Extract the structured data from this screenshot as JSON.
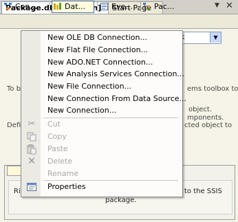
{
  "doc_tabs": {
    "active": "Package.dtsx [Design]*",
    "start": "Start Page",
    "pin_icon": "dropdown-arrow-icon",
    "close_icon": "close-icon"
  },
  "designer_tabs": [
    {
      "label": "Con...",
      "icon": "control-flow-icon"
    },
    {
      "label": "Dat...",
      "icon": "data-flow-icon"
    },
    {
      "label": "Eve...",
      "icon": "event-handlers-icon"
    },
    {
      "label": "Pac...",
      "icon": "package-explorer-icon"
    }
  ],
  "background_text": {
    "left_1": "To b",
    "right_1": "ems toolbox to",
    "right_2": "object.",
    "right_3": "mponents.",
    "left_2": "Defi",
    "right_4": "cted object to",
    "bottom_left": "Ri",
    "bottom_line1_right": "to the SSIS",
    "bottom_line2": "package."
  },
  "menu": {
    "new_items": [
      "New OLE DB Connection...",
      "New Flat File Connection...",
      "New ADO.NET Connection...",
      "New Analysis Services Connection...",
      "New File Connection...",
      "New Connection From Data Source...",
      "New Connection..."
    ],
    "edit_items": [
      {
        "label": "Cut",
        "icon": "cut-icon"
      },
      {
        "label": "Copy",
        "icon": "copy-icon"
      },
      {
        "label": "Paste",
        "icon": "paste-icon"
      },
      {
        "label": "Delete",
        "icon": "delete-icon"
      },
      {
        "label": "Rename",
        "icon": ""
      }
    ],
    "properties": {
      "label": "Properties",
      "icon": "properties-icon"
    }
  }
}
